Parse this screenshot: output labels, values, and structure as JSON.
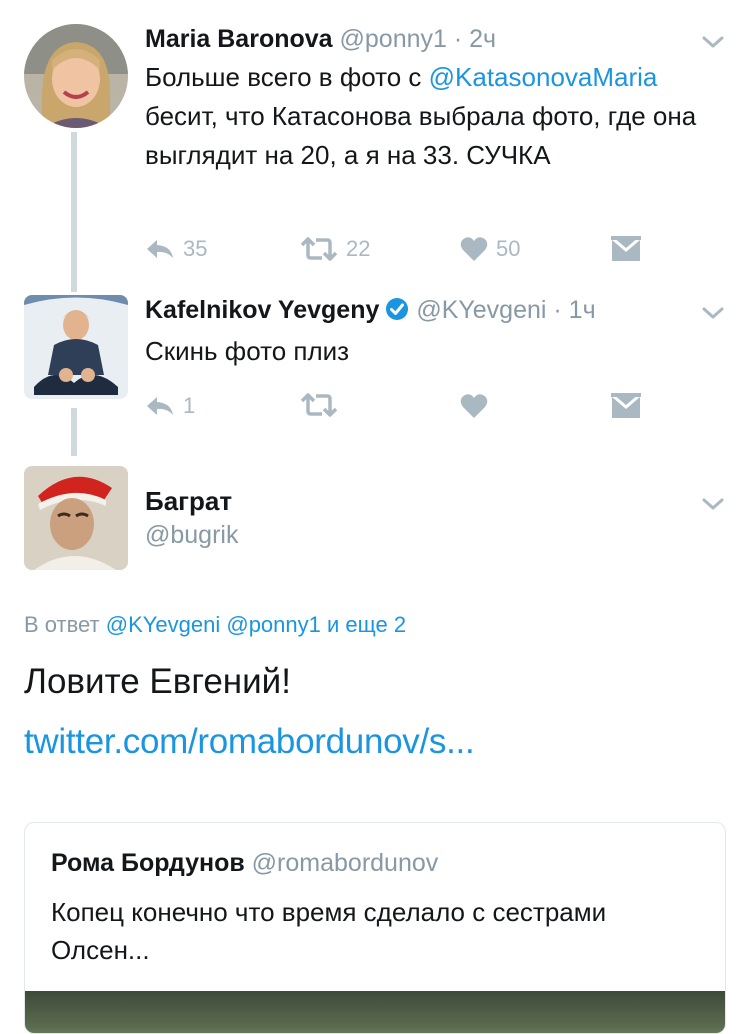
{
  "tweets": [
    {
      "name": "Maria Baronova",
      "handle": "@ponny1",
      "time": "· 2ч",
      "text_before": "Больше всего в фото с ",
      "mention": "@KatasonovaMaria",
      "text_after": " бесит, что Катасонова выбрала фото, где она выглядит на 20, а я на 33. СУЧКА",
      "replies": "35",
      "retweets": "22",
      "likes": "50"
    },
    {
      "name": "Kafelnikov Yevgeny",
      "handle": "@KYevgeni",
      "time": "· 1ч",
      "text": "Скинь фото плиз",
      "replies": "1"
    },
    {
      "name": "Баграт",
      "handle": "@bugrik"
    }
  ],
  "reply_to": {
    "prefix": "В ответ",
    "mentions": "@KYevgeni @ponny1 и еще 2"
  },
  "main_text": "Ловите Евгений!",
  "link": "twitter.com/romabordunov/s...",
  "quote": {
    "name": "Рома Бордунов",
    "handle": "@romabordunov",
    "text": "Копец конечно что время сделало с сестрами Олсен..."
  },
  "colors": {
    "accent": "#1b95e0",
    "muted": "#8899a6",
    "action": "#aab8c2",
    "thread": "#cfd9de"
  },
  "icons": [
    "reply-icon",
    "retweet-icon",
    "like-icon",
    "dm-icon",
    "chevron-down-icon",
    "verified-icon"
  ]
}
